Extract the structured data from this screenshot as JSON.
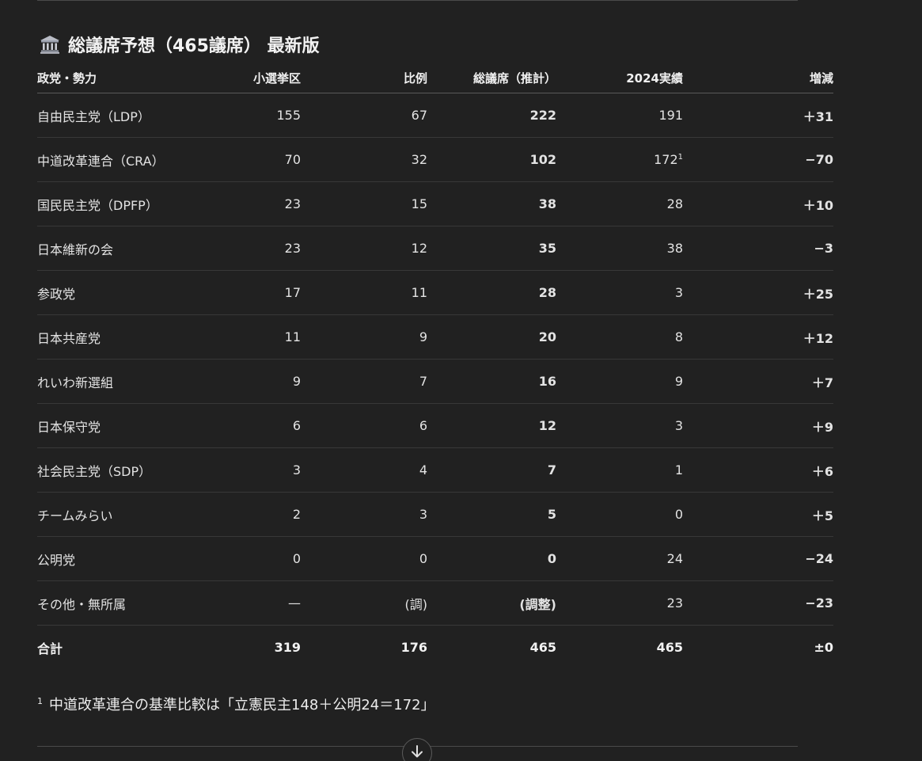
{
  "heading": {
    "icon": "classical-building-icon",
    "title": "総議席予想（465議席） 最新版"
  },
  "table": {
    "headers": {
      "party": "政党・勢力",
      "smd": "小選挙区",
      "pr": "比例",
      "total": "総議席（推計）",
      "y2024": "2024実績",
      "change": "増減"
    },
    "rows": [
      {
        "party": "自由民主党（LDP）",
        "smd": "155",
        "pr": "67",
        "total": "222",
        "y2024": "191",
        "y2024_note": "",
        "change": "＋31"
      },
      {
        "party": "中道改革連合（CRA）",
        "smd": "70",
        "pr": "32",
        "total": "102",
        "y2024": "172",
        "y2024_note": "1",
        "change": "−70"
      },
      {
        "party": "国民民主党（DPFP）",
        "smd": "23",
        "pr": "15",
        "total": "38",
        "y2024": "28",
        "y2024_note": "",
        "change": "＋10"
      },
      {
        "party": "日本維新の会",
        "smd": "23",
        "pr": "12",
        "total": "35",
        "y2024": "38",
        "y2024_note": "",
        "change": "−3"
      },
      {
        "party": "参政党",
        "smd": "17",
        "pr": "11",
        "total": "28",
        "y2024": "3",
        "y2024_note": "",
        "change": "＋25"
      },
      {
        "party": "日本共産党",
        "smd": "11",
        "pr": "9",
        "total": "20",
        "y2024": "8",
        "y2024_note": "",
        "change": "＋12"
      },
      {
        "party": "れいわ新選組",
        "smd": "9",
        "pr": "7",
        "total": "16",
        "y2024": "9",
        "y2024_note": "",
        "change": "＋7"
      },
      {
        "party": "日本保守党",
        "smd": "6",
        "pr": "6",
        "total": "12",
        "y2024": "3",
        "y2024_note": "",
        "change": "＋9"
      },
      {
        "party": "社会民主党（SDP）",
        "smd": "3",
        "pr": "4",
        "total": "7",
        "y2024": "1",
        "y2024_note": "",
        "change": "＋6"
      },
      {
        "party": "チームみらい",
        "smd": "2",
        "pr": "3",
        "total": "5",
        "y2024": "0",
        "y2024_note": "",
        "change": "＋5"
      },
      {
        "party": "公明党",
        "smd": "0",
        "pr": "0",
        "total": "0",
        "y2024": "24",
        "y2024_note": "",
        "change": "−24"
      },
      {
        "party": "その他・無所属",
        "smd": "—",
        "pr": "(調)",
        "total": "(調整)",
        "y2024": "23",
        "y2024_note": "",
        "change": "−23"
      }
    ],
    "total_row": {
      "party": "合計",
      "smd": "319",
      "pr": "176",
      "total": "465",
      "y2024": "465",
      "change": "±0"
    }
  },
  "footnote": {
    "marker": "1",
    "text": "中道改革連合の基準比較は「立憲民主148＋公明24＝172」"
  },
  "scroll_button": {
    "icon": "arrow-down-icon"
  },
  "colors": {
    "background": "#212121",
    "text": "#ececec",
    "rule": "#4a4a4a"
  }
}
